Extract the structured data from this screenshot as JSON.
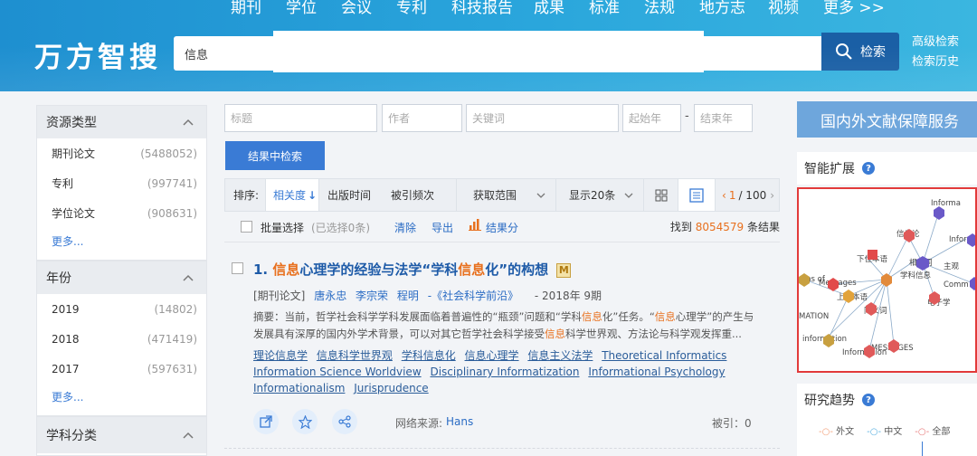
{
  "nav": {
    "items": [
      "期刊",
      "学位",
      "会议",
      "专利",
      "科技报告",
      "成果",
      "标准",
      "法规",
      "地方志",
      "视频",
      "更多 >>"
    ]
  },
  "logo": "万方智搜",
  "search": {
    "value": "信息",
    "button": "检索",
    "advanced": "高级检索",
    "history": "检索历史"
  },
  "facets": {
    "resource_type": {
      "title": "资源类型",
      "items": [
        {
          "label": "期刊论文",
          "count": "(5488052)"
        },
        {
          "label": "专利",
          "count": "(997741)"
        },
        {
          "label": "学位论文",
          "count": "(908631)"
        }
      ],
      "more": "更多..."
    },
    "year": {
      "title": "年份",
      "items": [
        {
          "label": "2019",
          "count": "(14802)"
        },
        {
          "label": "2018",
          "count": "(471419)"
        },
        {
          "label": "2017",
          "count": "(597631)"
        }
      ],
      "more": "更多..."
    },
    "subject": {
      "title": "学科分类"
    }
  },
  "adv_search": {
    "title_ph": "标题",
    "author_ph": "作者",
    "keyword_ph": "关键词",
    "start_ph": "起始年",
    "dash": "-",
    "end_ph": "结束年",
    "button": "结果中检索"
  },
  "sortbar": {
    "label": "排序:",
    "relevance": "相关度",
    "pubtime": "出版时间",
    "cited": "被引频次",
    "scope": "获取范围",
    "pagesize": "显示20条",
    "page_current": "1",
    "page_total": "/ 100"
  },
  "batch": {
    "select": "批量选择",
    "selected": "(已选择0条)",
    "clear": "清除",
    "export": "导出",
    "analyze": "结果分",
    "found_prefix": "找到",
    "found_count": "8054579",
    "found_suffix": "条结果"
  },
  "result": {
    "index": "1.",
    "title_parts": [
      "信息",
      "心理学的经验与法学“学科",
      "信息",
      "化”的构想"
    ],
    "type": "[期刊论文]",
    "authors": [
      "唐永忠",
      "李宗荣",
      "程明"
    ],
    "journal": "-《社会科学前沿》",
    "date": "- 2018年 9期",
    "abstract_parts": [
      "摘要：当前，哲学社会科学学科发展面临着普遍性的“瓶颈”问题和“学科",
      "信息",
      "化”任务。“",
      "信息",
      "心理学”的产生与发展具有深厚的国内外学术背景，可以对其它哲学社会科学接受",
      "信息",
      "科学世界观、方法论与科学观发挥重..."
    ],
    "keywords": [
      "理论信息学",
      "信息科学世界观",
      "学科信息化",
      "信息心理学",
      "信息主义法学",
      "Theoretical Informatics",
      "Information Science Worldview",
      "Disciplinary Informatization",
      "Informational Psychology",
      "Informationalism",
      "Jurisprudence"
    ],
    "source_label": "网络来源:",
    "source": "Hans",
    "cited": "被引：0"
  },
  "right": {
    "banner": "国内外文献保障服务",
    "smart_expand": "智能扩展",
    "trend": "研究趋势",
    "trend_legend": [
      "外文",
      "中文",
      "全部"
    ],
    "graph_labels": [
      "信息论",
      "Inform",
      "Informa",
      "下位本语",
      "相关词",
      "学科信息",
      "主观",
      "Comm",
      "Messages",
      "上位本语",
      "ams of",
      "同义词",
      "电子学",
      "MATION",
      "information",
      "MESSAGES",
      "Information"
    ]
  },
  "colors": {
    "header": "#1e8fd0",
    "accent": "#3a7bd5",
    "highlight": "#e8701e",
    "red_border": "#e23a3a"
  }
}
